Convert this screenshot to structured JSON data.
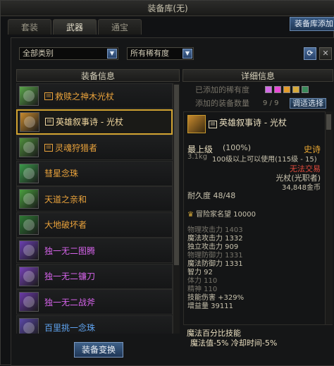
{
  "window": {
    "title": "装备库(无)"
  },
  "tabs": [
    {
      "label": "套装",
      "active": false
    },
    {
      "label": "武器",
      "active": true
    },
    {
      "label": "通宝",
      "active": false
    }
  ],
  "top_button": {
    "label": "装备库添加"
  },
  "filters": {
    "category": "全部类别",
    "rarity": "所有稀有度",
    "dropdown_icon": "triangle-down",
    "refresh_icon": "refresh-arrows",
    "close_icon": "x"
  },
  "left_panel": {
    "header": "装备信息",
    "items": [
      {
        "name": "救赎之神木光杖",
        "color": "#e9a23b",
        "badge": "III",
        "icon_color": "#5aa64a",
        "selected": false
      },
      {
        "name": "英雄叙事诗 - 光杖",
        "color": "#f3d9a0",
        "badge": "III",
        "icon_color": "#c78a2e",
        "selected": true
      },
      {
        "name": "灵魂狩猎者",
        "color": "#e9a23b",
        "badge": "III",
        "icon_color": "#4f8f3c",
        "selected": false
      },
      {
        "name": "彗星念珠",
        "color": "#e9a23b",
        "badge": "",
        "icon_color": "#3b9a4a",
        "selected": false
      },
      {
        "name": "天道之亲和",
        "color": "#e9a23b",
        "badge": "",
        "icon_color": "#4aa03e",
        "selected": false
      },
      {
        "name": "大地破坏者",
        "color": "#e9a23b",
        "badge": "",
        "icon_color": "#2e7a34",
        "selected": false
      },
      {
        "name": "独一无二图腾",
        "color": "#d563ea",
        "badge": "",
        "icon_color": "#6a3fb0",
        "selected": false
      },
      {
        "name": "独一无二镰刀",
        "color": "#d563ea",
        "badge": "",
        "icon_color": "#7742b8",
        "selected": false
      },
      {
        "name": "独一无二战斧",
        "color": "#d563ea",
        "badge": "",
        "icon_color": "#6b3aa8",
        "selected": false
      },
      {
        "name": "百里挑一念珠",
        "color": "#5fa3f0",
        "badge": "",
        "icon_color": "#5a48a8",
        "selected": false
      }
    ],
    "scroll_fraction": 0.72,
    "swap_button": "装备变换"
  },
  "right_panel": {
    "header": "详细信息",
    "rarity_label": "已添加的稀有度",
    "rarity_colors": [
      "#d36ae6",
      "#e84ad6",
      "#e29a2b",
      "#d6a93a",
      "#3a8a5a"
    ],
    "count_label": "添加的装备数量",
    "count_value": "9 / 9",
    "adjust_button": "调适选择",
    "detail": {
      "name": "英雄叙事诗 - 光杖",
      "grade_label": "最上级",
      "grade_pct": "(100%)",
      "rarity": "史诗",
      "weight": "3.1kg",
      "level_req": "100级以上可以使用(115级 - 15)",
      "trade": "无法交易",
      "type": "光杖(光职者)",
      "price": "34,848金币",
      "durability": "耐久度 48/48",
      "adventure": "冒险家名望 10000",
      "stats": [
        {
          "text": "物理攻击力 1403",
          "color": "#77746a"
        },
        {
          "text": "魔法攻击力 1332",
          "color": "#c9c3ae"
        },
        {
          "text": "独立攻击力 909",
          "color": "#c9c3ae"
        },
        {
          "text": "物理防御力 1331",
          "color": "#77746a"
        },
        {
          "text": "魔法防御力 1331",
          "color": "#c9c3ae"
        },
        {
          "text": "智力 92",
          "color": "#c9c3ae"
        },
        {
          "text": "体力 110",
          "color": "#77746a"
        },
        {
          "text": "精神 110",
          "color": "#77746a"
        },
        {
          "text": "技能伤害 +329%",
          "color": "#c9c3ae"
        },
        {
          "text": "增益量 39111",
          "color": "#c9c3ae"
        }
      ],
      "skill_title": "魔法百分比技能",
      "skill_desc": "魔法值-5% 冷却时间-5%"
    }
  }
}
